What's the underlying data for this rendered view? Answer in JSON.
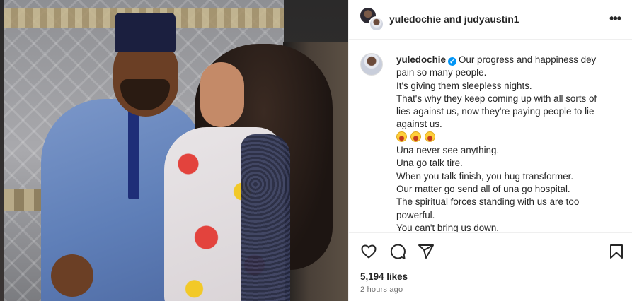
{
  "post": {
    "header_title": "yuledochie and judyaustin1",
    "caption": {
      "username": "yuledochie",
      "first_line": "Our progress and happiness dey",
      "lines": [
        "pain so many people.",
        "It's giving them sleepless nights.",
        "That's why they keep coming up with all sorts of",
        "lies against us, now they're paying people to lie",
        "against us."
      ],
      "emojis": [
        "grinning-face-emoji",
        "grinning-face-emoji",
        "grinning-face-emoji"
      ],
      "lines_after": [
        "Una never see anything.",
        "Una go talk tire.",
        "When you talk finish, you hug transformer.",
        "Our matter go send all of una go hospital.",
        "The spiritual forces standing with us are too",
        "powerful.",
        "You can't bring us down."
      ]
    },
    "likes": "5,194 likes",
    "timestamp": "2 hours ago"
  },
  "icons": {
    "more": "more-options-icon",
    "like": "heart-icon",
    "comment": "comment-icon",
    "share": "share-icon",
    "save": "bookmark-icon",
    "verified": "verified-badge-icon"
  },
  "colors": {
    "verified_blue": "#0095f6",
    "text": "#262626",
    "muted": "#737373",
    "border": "#efefef"
  }
}
